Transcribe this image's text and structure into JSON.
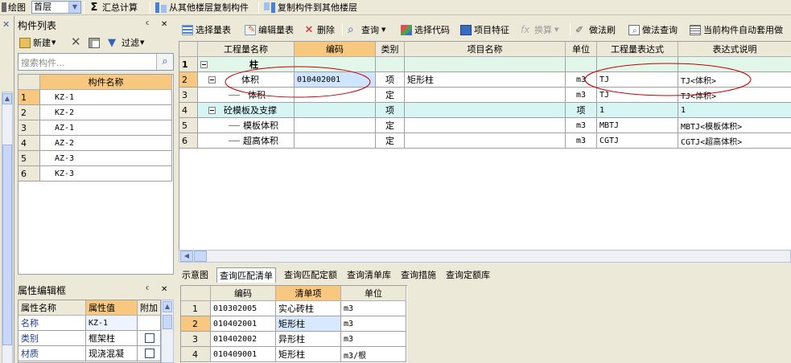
{
  "toolbar": {
    "mode_label": "绘图",
    "floor_value": "首层",
    "sum_calc": "汇总计算",
    "copy_from_floor": "从其他楼层复制构件",
    "copy_to_floor": "复制构件到其他楼层"
  },
  "component_panel": {
    "title": "构件列表",
    "new_label": "新建",
    "filter_label": "过滤",
    "search_placeholder": "搜索构件...",
    "column_header": "构件名称",
    "rows": [
      {
        "num": "1",
        "name": "KZ-1"
      },
      {
        "num": "2",
        "name": "KZ-2"
      },
      {
        "num": "3",
        "name": "AZ-1"
      },
      {
        "num": "4",
        "name": "AZ-2"
      },
      {
        "num": "5",
        "name": "AZ-3"
      },
      {
        "num": "6",
        "name": "KZ-3"
      }
    ]
  },
  "property_panel": {
    "title": "属性编辑框",
    "headers": [
      "属性名称",
      "属性值",
      "附加"
    ],
    "rows": [
      {
        "name": "名称",
        "value": "KZ-1"
      },
      {
        "name": "类别",
        "value": "框架柱"
      },
      {
        "name": "材质",
        "value": "现浇混凝"
      }
    ]
  },
  "main_toolbar": {
    "select_qty": "选择量表",
    "edit_qty": "编辑量表",
    "delete": "删除",
    "query": "查询",
    "select_code": "选择代码",
    "item_feature": "项目特征",
    "convert": "换算",
    "method_brush": "做法刷",
    "method_query": "做法查询",
    "auto_apply": "当前构件自动套用做"
  },
  "main_grid": {
    "headers": [
      "工程量名称",
      "编码",
      "类别",
      "项目名称",
      "单位",
      "工程量表达式",
      "表达式说明"
    ],
    "rows": [
      {
        "num": "1",
        "name": "柱",
        "code": "",
        "cat": "",
        "item": "",
        "unit": "",
        "expr": "",
        "desc": ""
      },
      {
        "num": "2",
        "name": "体积",
        "code": "010402001",
        "cat": "项",
        "item": "矩形柱",
        "unit": "m3",
        "expr": "TJ",
        "desc": "TJ<体积>"
      },
      {
        "num": "3",
        "name": "体积",
        "code": "",
        "cat": "定",
        "item": "",
        "unit": "m3",
        "expr": "TJ",
        "desc": "TJ<体积>"
      },
      {
        "num": "4",
        "name": "砼模板及支撑",
        "code": "",
        "cat": "项",
        "item": "",
        "unit": "项",
        "expr": "1",
        "desc": "1"
      },
      {
        "num": "5",
        "name": "模板体积",
        "code": "",
        "cat": "定",
        "item": "",
        "unit": "m3",
        "expr": "MBTJ",
        "desc": "MBTJ<模板体积>"
      },
      {
        "num": "6",
        "name": "超高体积",
        "code": "",
        "cat": "定",
        "item": "",
        "unit": "m3",
        "expr": "CGTJ",
        "desc": "CGTJ<超高体积>"
      }
    ]
  },
  "bottom_tabs": [
    "示意图",
    "查询匹配清单",
    "查询匹配定额",
    "查询清单库",
    "查询措施",
    "查询定额库"
  ],
  "bottom_grid": {
    "headers": [
      "编码",
      "清单项",
      "单位"
    ],
    "rows": [
      {
        "num": "1",
        "code": "010302005",
        "item": "实心砖柱",
        "unit": "m3"
      },
      {
        "num": "2",
        "code": "010402001",
        "item": "矩形柱",
        "unit": "m3"
      },
      {
        "num": "3",
        "code": "010402002",
        "item": "异形柱",
        "unit": "m3"
      },
      {
        "num": "4",
        "code": "010409001",
        "item": "矩形柱",
        "unit": "m3/根"
      }
    ]
  },
  "colors": {
    "annotation_ellipse": "#c00000",
    "selected_header": "#f8c880",
    "group_row": "#e2f7e9",
    "sub_group_row": "#d6f5f3"
  }
}
